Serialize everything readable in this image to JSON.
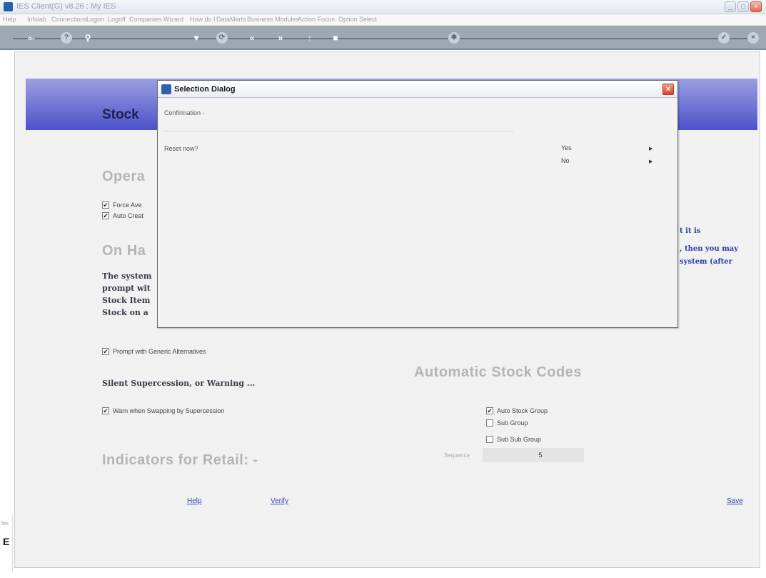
{
  "window": {
    "title": "IES Client(G) v8.26 : My IES"
  },
  "menu": [
    "Help",
    "Infolab",
    "Connections",
    "Logon",
    "Logoff",
    "Companies",
    "Wizard",
    "How do I",
    "DataMarts",
    "Business Modules",
    "Action Focus",
    "Option Select"
  ],
  "header": {
    "title": "Stock"
  },
  "sections": {
    "operations": "Opera",
    "on_hand": "On Ha",
    "automatic_codes": "Automatic Stock Codes",
    "indicators": "Indicators for Retail: -"
  },
  "checkboxes": {
    "force_ave": "Force Ave",
    "auto_creat": "Auto Creat",
    "prompt_generic": "Prompt with Generic Alternatives",
    "warn_swapping": "Warn when Swapping by Supercession",
    "auto_stock_group": "Auto Stock Group",
    "sub_group": "Sub Group",
    "sub_sub_group": "Sub Sub Group"
  },
  "body_text": {
    "line1": "The system",
    "line2": "prompt wit",
    "line3": "Stock Item",
    "line4": "Stock on a",
    "right1": "t it is",
    "right2": ", then you may",
    "right3": "system (after",
    "silent": "Silent Supercession, or Warning ..."
  },
  "sequence": {
    "label": "Sequence",
    "value": "5"
  },
  "links": {
    "help": "Help",
    "verify": "Verify",
    "save": "Save"
  },
  "left_stub": {
    "t1": "Tes",
    "t2": "E"
  },
  "dialog": {
    "title": "Selection Dialog",
    "confirmation": "Confirmation -",
    "question": "Reset now?",
    "options": [
      "Yes",
      "No"
    ]
  }
}
